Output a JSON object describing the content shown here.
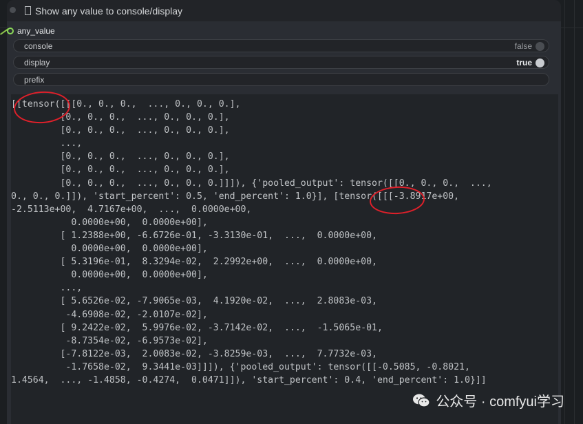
{
  "node": {
    "title": "Show any value to console/display",
    "input_label": "any_value"
  },
  "widgets": {
    "console": {
      "label": "console",
      "value": "false"
    },
    "display": {
      "label": "display",
      "value": "true"
    },
    "prefix": {
      "label": "prefix",
      "value": ""
    }
  },
  "output": {
    "text": "[[tensor([[[0., 0., 0.,  ..., 0., 0., 0.],\n         [0., 0., 0.,  ..., 0., 0., 0.],\n         [0., 0., 0.,  ..., 0., 0., 0.],\n         ...,\n         [0., 0., 0.,  ..., 0., 0., 0.],\n         [0., 0., 0.,  ..., 0., 0., 0.],\n         [0., 0., 0.,  ..., 0., 0., 0.]]]), {'pooled_output': tensor([[0., 0., 0.,  ...,\n0., 0., 0.]]), 'start_percent': 0.5, 'end_percent': 1.0}], [tensor([[[-3.8917e+00,\n-2.5113e+00,  4.7167e+00,  ...,  0.0000e+00,\n           0.0000e+00,  0.0000e+00],\n         [ 1.2388e+00, -6.6726e-01, -3.3130e-01,  ...,  0.0000e+00,\n           0.0000e+00,  0.0000e+00],\n         [ 5.3196e-01,  8.3294e-02,  2.2992e+00,  ...,  0.0000e+00,\n           0.0000e+00,  0.0000e+00],\n         ...,\n         [ 5.6526e-02, -7.9065e-03,  4.1920e-02,  ...,  2.8083e-03,\n          -4.6908e-02, -2.0107e-02],\n         [ 9.2422e-02,  5.9976e-02, -3.7142e-02,  ...,  -1.5065e-01,\n          -8.7354e-02, -6.9573e-02],\n         [-7.8122e-03,  2.0083e-02, -3.8259e-03,  ...,  7.7732e-03,\n          -1.7658e-02,  9.3441e-03]]]), {'pooled_output': tensor([[-0.5085, -0.8021,\n1.4564,  ..., -1.4858, -0.4274,  0.0471]]), 'start_percent': 0.4, 'end_percent': 1.0}]]"
  },
  "watermark": {
    "icon": "wechat-icon",
    "text": "公众号 · comfyui学习"
  },
  "colors": {
    "annotation_circle": "#e0202a",
    "input_slot": "#8bd95a",
    "toggle_on": "#c9ccd0",
    "toggle_off": "#4a4d52"
  }
}
